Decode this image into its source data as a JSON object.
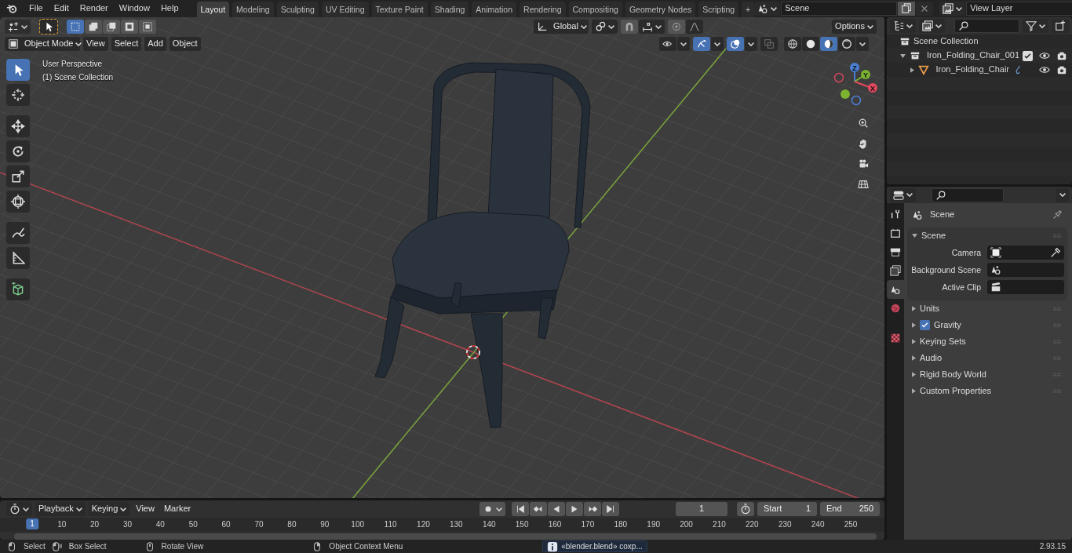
{
  "menu": [
    "File",
    "Edit",
    "Render",
    "Window",
    "Help"
  ],
  "workspaces": [
    {
      "label": "Layout",
      "selected": true
    },
    {
      "label": "Modeling",
      "selected": false
    },
    {
      "label": "Sculpting",
      "selected": false
    },
    {
      "label": "UV Editing",
      "selected": false
    },
    {
      "label": "Texture Paint",
      "selected": false
    },
    {
      "label": "Shading",
      "selected": false
    },
    {
      "label": "Animation",
      "selected": false
    },
    {
      "label": "Rendering",
      "selected": false
    },
    {
      "label": "Compositing",
      "selected": false
    },
    {
      "label": "Geometry Nodes",
      "selected": false
    },
    {
      "label": "Scripting",
      "selected": false
    }
  ],
  "add_workspace": "+",
  "scene_selector": {
    "value": "Scene"
  },
  "view_layer_selector": {
    "value": "View Layer"
  },
  "viewport": {
    "select_modes": [
      {
        "selected": true
      },
      {
        "selected": false
      },
      {
        "selected": false
      },
      {
        "selected": false
      },
      {
        "selected": false
      }
    ],
    "orientation": "Global",
    "options": "Options",
    "mode": "Object Mode",
    "menus": [
      "View",
      "Select",
      "Add",
      "Object"
    ],
    "toggles": [
      {
        "kind": "visibility",
        "selected": false
      },
      {
        "kind": "gizmo",
        "selected": true
      },
      {
        "kind": "overlay",
        "selected": true
      },
      {
        "kind": "xray",
        "selected": false
      }
    ],
    "shading": [
      {
        "kind": "wireframe",
        "selected": false
      },
      {
        "kind": "solid",
        "selected": false
      },
      {
        "kind": "material",
        "selected": true
      },
      {
        "kind": "rendered",
        "selected": false
      }
    ],
    "overlay_text": [
      "User Perspective",
      "(1) Scene Collection"
    ],
    "tools": [
      {
        "kind": "select",
        "selected": true
      },
      {
        "kind": "cursor",
        "selected": false
      },
      {
        "kind": "move",
        "selected": false
      },
      {
        "kind": "rotate",
        "selected": false
      },
      {
        "kind": "scale",
        "selected": false
      },
      {
        "kind": "transform",
        "selected": false
      },
      {
        "kind": "annotate",
        "selected": false
      },
      {
        "kind": "measure",
        "selected": false
      },
      {
        "kind": "add_cube",
        "selected": false
      }
    ],
    "gizmo_axes": [
      "Z",
      "Y",
      "X"
    ]
  },
  "outliner": {
    "root": "Scene Collection",
    "items": [
      {
        "label": "Iron_Folding_Chair_001",
        "kind": "collection",
        "expanded": true,
        "checked": true,
        "children": [
          {
            "label": "Iron_Folding_Chair",
            "kind": "mesh",
            "expanded": false
          }
        ]
      }
    ]
  },
  "properties": {
    "context": "Scene",
    "tabs": [
      {
        "kind": "tool",
        "selected": false
      },
      {
        "kind": "render",
        "selected": false
      },
      {
        "kind": "output",
        "selected": false
      },
      {
        "kind": "view_layer",
        "selected": false
      },
      {
        "kind": "scene",
        "selected": true
      },
      {
        "kind": "world",
        "selected": false
      },
      {
        "kind": "texture",
        "selected": false
      }
    ],
    "panel": {
      "title": "Scene",
      "expanded": true,
      "fields": [
        {
          "label": "Camera",
          "kind": "camera"
        },
        {
          "label": "Background Scene",
          "kind": "scene"
        },
        {
          "label": "Active Clip",
          "kind": "clip"
        }
      ]
    },
    "sections": [
      {
        "label": "Units",
        "expanded": false
      },
      {
        "label": "Gravity",
        "expanded": false,
        "checked": true
      },
      {
        "label": "Keying Sets",
        "expanded": false
      },
      {
        "label": "Audio",
        "expanded": false
      },
      {
        "label": "Rigid Body World",
        "expanded": false
      },
      {
        "label": "Custom Properties",
        "expanded": false
      }
    ]
  },
  "timeline": {
    "auto_keying": {
      "on": false
    },
    "menus": [
      "Playback",
      "Keying",
      "View",
      "Marker"
    ],
    "current_frame": "1",
    "start_label": "Start",
    "start": "1",
    "end_label": "End",
    "end": "250",
    "playhead": "1",
    "ticks": [
      "10",
      "20",
      "30",
      "40",
      "50",
      "60",
      "70",
      "80",
      "90",
      "100",
      "110",
      "120",
      "130",
      "140",
      "150",
      "160",
      "170",
      "180",
      "190",
      "200",
      "210",
      "220",
      "230",
      "240",
      "250"
    ]
  },
  "status_bar": {
    "hints": [
      {
        "label": "Select",
        "kind": "left"
      },
      {
        "label": "Box Select",
        "kind": "drag"
      },
      {
        "label": "Rotate View",
        "kind": "middle"
      },
      {
        "label": "Object Context Menu",
        "kind": "right"
      }
    ],
    "report": "«blender.blend» coxp...",
    "version": "2.93.15"
  }
}
